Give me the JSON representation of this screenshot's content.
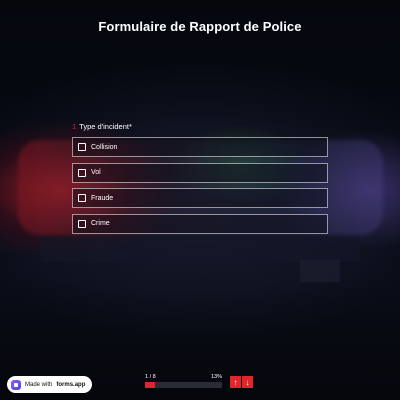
{
  "form": {
    "title": "Formulaire de Rapport de Police"
  },
  "question": {
    "number": "1",
    "label": "Type d'incident",
    "required_marker": "*",
    "options": [
      {
        "label": "Collision",
        "checked": false
      },
      {
        "label": "Vol",
        "checked": false
      },
      {
        "label": "Fraude",
        "checked": false
      },
      {
        "label": "Crime",
        "checked": false
      }
    ]
  },
  "progress": {
    "page_text": "1 / 8",
    "percent_text": "13%",
    "percent": 13
  },
  "navigation": {
    "up_icon": "arrow-up-icon",
    "down_icon": "arrow-down-icon"
  },
  "branding": {
    "prefix": "Made with",
    "name": "forms.app"
  },
  "colors": {
    "accent": "#e0262a",
    "text": "#ffffff",
    "background": "#060810"
  }
}
